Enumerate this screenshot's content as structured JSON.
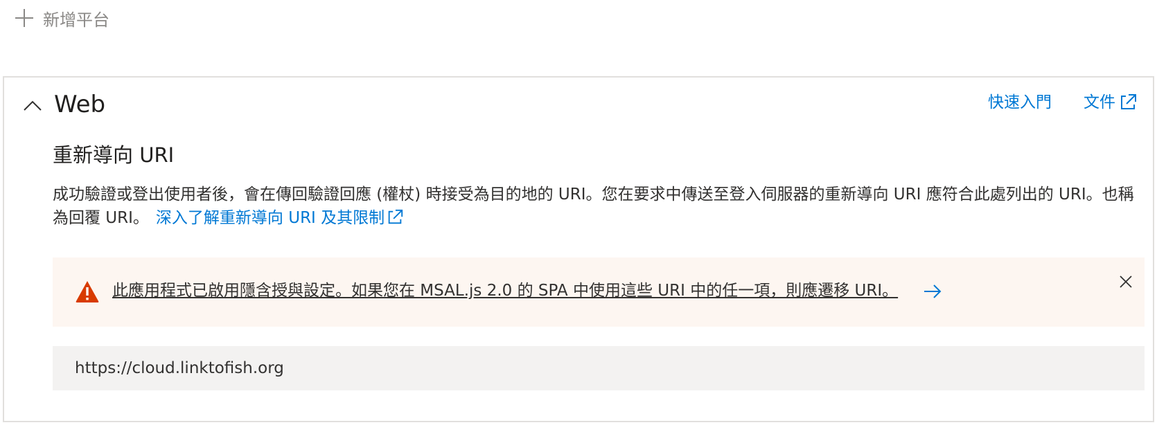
{
  "toolbar": {
    "add_platform_label": "新增平台",
    "add_icon": "plus-icon"
  },
  "platform_card": {
    "title": "Web",
    "collapse_icon": "chevron-up-icon",
    "quickstart_label": "快速入門",
    "docs_label": "文件",
    "external_icon": "external-link-icon"
  },
  "redirect_section": {
    "title": "重新導向 URI",
    "description": "成功驗證或登出使用者後，會在傳回驗證回應 (權杖) 時接受為目的地的 URI。您在要求中傳送至登入伺服器的重新導向 URI 應符合此處列出的 URI。也稱為回覆 URI。",
    "learn_more_label": "深入了解重新導向 URI 及其限制"
  },
  "warning_banner": {
    "message": "此應用程式已啟用隱含授與設定。如果您在 MSAL.js 2.0 的 SPA 中使用這些 URI 中的任一項，則應遷移 URI。",
    "icon": "warning-icon",
    "arrow_icon": "arrow-right-icon",
    "close_icon": "close-icon",
    "background_color": "#fdf6f1",
    "icon_color": "#d83b01"
  },
  "redirect_uris": [
    {
      "value": "https://cloud.linktofish.org"
    }
  ],
  "colors": {
    "link": "#0078d4",
    "text": "#323130",
    "muted": "#8a8886",
    "field_background": "#f3f2f1",
    "border": "#e1dfdd"
  }
}
